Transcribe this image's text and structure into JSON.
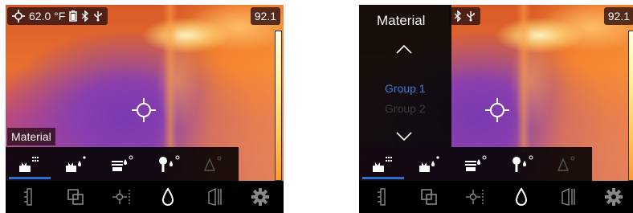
{
  "left_screen": {
    "status": {
      "temperature_label": "62.0 °F",
      "icons": [
        "target-icon",
        "battery-icon",
        "bluetooth-icon",
        "usb-icon"
      ]
    },
    "max_temp": "92.1",
    "material_label": "Material",
    "mode_icons": [
      "material-icon",
      "emissivity-dot-icon",
      "surface-dot-icon",
      "probe-dot-icon",
      "delta-icon"
    ],
    "tool_icons": [
      "ruler-icon",
      "layers-icon",
      "spot-icon",
      "droplet-icon",
      "wall-icon",
      "gear-icon"
    ]
  },
  "right_screen": {
    "status": {
      "icons": [
        "bluetooth-icon",
        "usb-icon"
      ]
    },
    "max_temp": "92.1",
    "panel": {
      "title": "Material",
      "groups": [
        "Group 1",
        "Group 2"
      ],
      "selected_group": "Group 1"
    },
    "mode_icons": [
      "material-icon",
      "emissivity-dot-icon",
      "surface-dot-icon",
      "probe-dot-icon",
      "delta-icon"
    ],
    "tool_icons": [
      "ruler-icon",
      "layers-icon",
      "spot-icon",
      "droplet-icon",
      "wall-icon",
      "gear-icon"
    ]
  },
  "colors": {
    "accent": "#2a6fd0",
    "selected_group": "#3a7bd5",
    "disabled_group": "#3a3a3a",
    "crosshair": "#ffffff"
  }
}
